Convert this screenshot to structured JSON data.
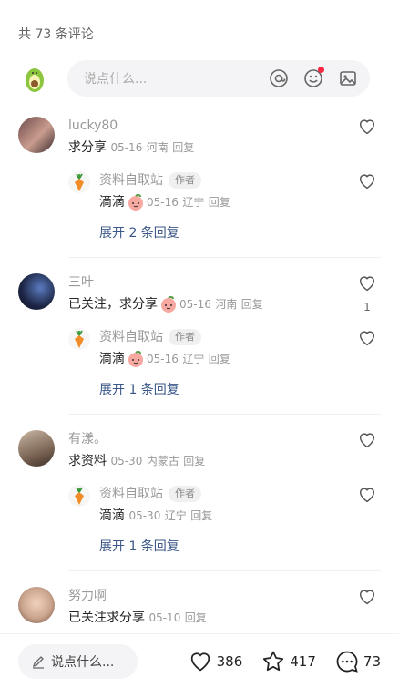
{
  "header": {
    "count_label": "共 73 条评论"
  },
  "composer": {
    "placeholder": "说点什么..."
  },
  "comments": [
    {
      "name": "lucky80",
      "text": "求分享",
      "date": "05-16",
      "region": "河南",
      "reply_label": "回复",
      "likes": "",
      "reply": {
        "name": "资料自取站",
        "badge": "作者",
        "text": "滴滴",
        "date": "05-16",
        "region": "辽宁",
        "reply_label": "回复"
      },
      "expand": "展开 2 条回复"
    },
    {
      "name": "三叶",
      "text": "已关注，求分享",
      "date": "05-16",
      "region": "河南",
      "reply_label": "回复",
      "likes": "1",
      "reply": {
        "name": "资料自取站",
        "badge": "作者",
        "text": "滴滴",
        "date": "05-16",
        "region": "辽宁",
        "reply_label": "回复"
      },
      "expand": "展开 1 条回复"
    },
    {
      "name": "有漾。",
      "text": "求资料",
      "date": "05-30",
      "region": "内蒙古",
      "reply_label": "回复",
      "likes": "",
      "reply": {
        "name": "资料自取站",
        "badge": "作者",
        "text": "滴滴",
        "date": "05-30",
        "region": "辽宁",
        "reply_label": "回复"
      },
      "expand": "展开 1 条回复"
    },
    {
      "name": "努力啊",
      "text": "已关注求分享",
      "date": "05-10",
      "region": "",
      "reply_label": "回复",
      "likes": ""
    }
  ],
  "bottom_bar": {
    "input_placeholder": "说点什么...",
    "likes": "386",
    "favorites": "417",
    "comments": "73"
  },
  "colors": {
    "accent_link": "#3b5788",
    "notification_dot": "#ff2442",
    "muted_text": "#999999"
  },
  "icons": [
    "avocado-icon",
    "at-icon",
    "emoji-icon",
    "image-icon",
    "heart-icon",
    "carrot-icon",
    "peach-emoji-icon",
    "pencil-icon",
    "star-icon",
    "comment-bubble-icon"
  ]
}
